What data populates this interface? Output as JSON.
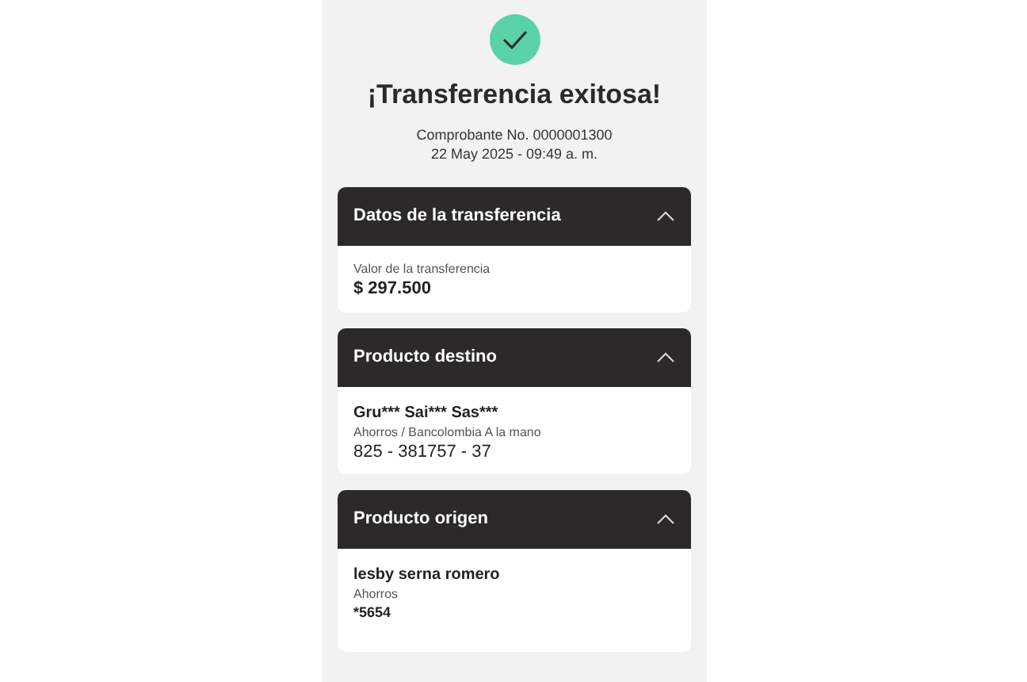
{
  "status": {
    "title": "¡Transferencia exitosa!",
    "receipt": "Comprobante No. 0000001300",
    "date": "22 May 2025 - 09:49 a. m."
  },
  "sections": [
    {
      "title": "Datos de la transferencia",
      "expanded": true,
      "lines": [
        {
          "kind": "caption",
          "text": "Valor de la transferencia"
        },
        {
          "kind": "amount",
          "text": "$ 297.500"
        }
      ]
    },
    {
      "title": "Producto destino",
      "expanded": true,
      "lines": [
        {
          "kind": "name",
          "text": "Gru*** Sai*** Sas***"
        },
        {
          "kind": "caption",
          "text": "Ahorros / Bancolombia A la mano"
        },
        {
          "kind": "number",
          "text": "825 - 381757 - 37"
        }
      ]
    },
    {
      "title": "Producto origen",
      "expanded": true,
      "lines": [
        {
          "kind": "name",
          "text": "lesby serna romero"
        },
        {
          "kind": "caption",
          "text": "Ahorros"
        },
        {
          "kind": "account",
          "text": "*5654"
        }
      ]
    }
  ]
}
